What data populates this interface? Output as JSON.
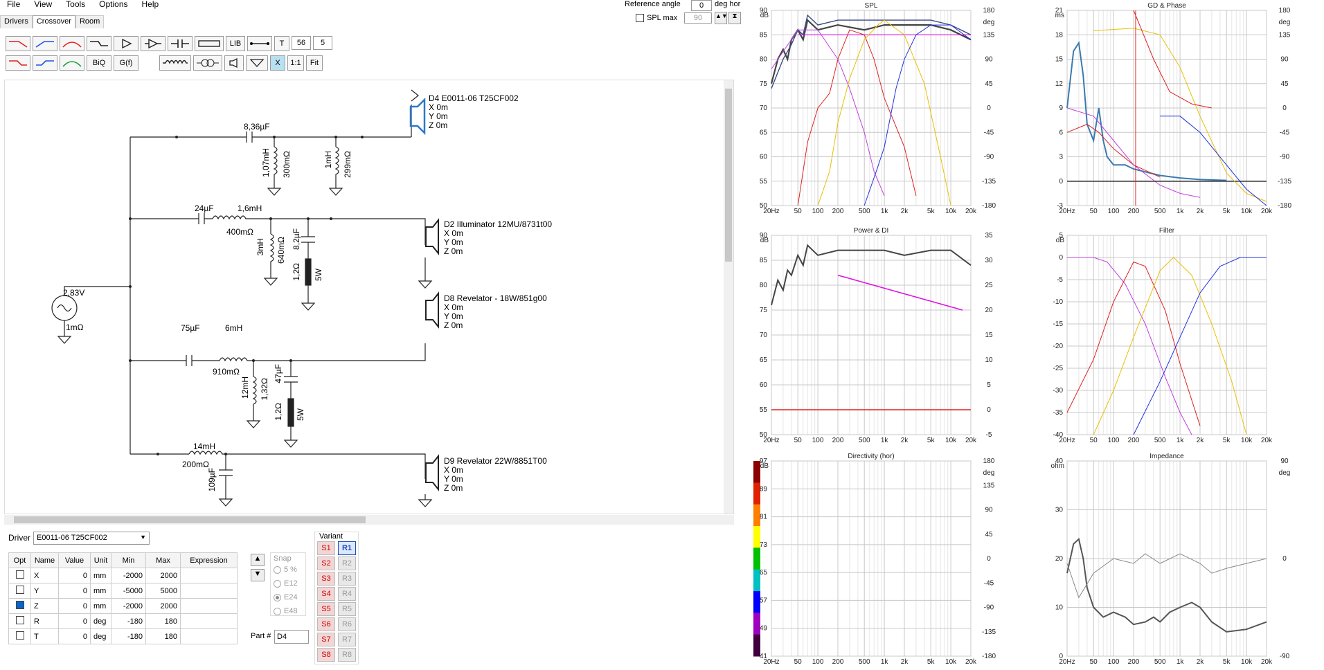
{
  "menu": [
    "File",
    "View",
    "Tools",
    "Options",
    "Help"
  ],
  "tabs": [
    "Drivers",
    "Crossover",
    "Room"
  ],
  "active_tab": "Crossover",
  "reference": {
    "label": "Reference angle",
    "value": "0",
    "unit": "deg hor",
    "splmax_label": "SPL max",
    "splmax_value": "90"
  },
  "toolbar": {
    "lib": "LIB",
    "t": "T",
    "num1": "56",
    "num2": "5",
    "biq": "BiQ",
    "gf": "G(f)",
    "x": "X",
    "oneone": "1:1",
    "fit": "Fit"
  },
  "schematic": {
    "source": {
      "voltage": "2,83V",
      "r": "1mΩ"
    },
    "labels": [
      "8,36µF",
      "1,07mH",
      "300mΩ",
      "1mH",
      "299mΩ",
      "24µF",
      "1,6mH",
      "400mΩ",
      "3mH",
      "640mΩ",
      "8,2µF",
      "1,2Ω",
      "5W",
      "75µF",
      "6mH",
      "910mΩ",
      "12mH",
      "1,32Ω",
      "47µF",
      "1,2Ω",
      "5W",
      "14mH",
      "200mΩ",
      "109µF"
    ],
    "drivers": [
      {
        "name": "D4 E0011-06 T25CF002",
        "x": "X 0m",
        "y": "Y 0m",
        "z": "Z 0m"
      },
      {
        "name": "D2 Illuminator 12MU/8731t00",
        "x": "X 0m",
        "y": "Y 0m",
        "z": "Z 0m"
      },
      {
        "name": "D8 Revelator - 18W/851g00",
        "x": "X 0m",
        "y": "Y 0m",
        "z": "Z 0m"
      },
      {
        "name": "D9 Revelator 22W/8851T00",
        "x": "X 0m",
        "y": "Y 0m",
        "z": "Z 0m"
      }
    ]
  },
  "driver_select": {
    "label": "Driver",
    "value": "E0011-06 T25CF002"
  },
  "param_table": {
    "headers": [
      "Opt",
      "Name",
      "Value",
      "Unit",
      "Min",
      "Max",
      "Expression"
    ],
    "rows": [
      {
        "name": "X",
        "value": "0",
        "unit": "mm",
        "min": "-2000",
        "max": "2000"
      },
      {
        "name": "Y",
        "value": "0",
        "unit": "mm",
        "min": "-5000",
        "max": "5000"
      },
      {
        "name": "Z",
        "value": "0",
        "unit": "mm",
        "min": "-2000",
        "max": "2000"
      },
      {
        "name": "R",
        "value": "0",
        "unit": "deg",
        "min": "-180",
        "max": "180"
      },
      {
        "name": "T",
        "value": "0",
        "unit": "deg",
        "min": "-180",
        "max": "180"
      }
    ]
  },
  "snap": {
    "label": "Snap",
    "options": [
      "5 %",
      "E12",
      "E24",
      "E48"
    ],
    "selected": "E24"
  },
  "part": {
    "label": "Part #",
    "value": "D4"
  },
  "variant": {
    "label": "Variant",
    "s": [
      "S1",
      "S2",
      "S3",
      "S4",
      "S5",
      "S6",
      "S7",
      "S8"
    ],
    "r": [
      "R1",
      "R2",
      "R3",
      "R4",
      "R5",
      "R6",
      "R7",
      "R8"
    ],
    "selected": "R1"
  },
  "graphs": {
    "spl": {
      "title": "SPL",
      "left_unit": "dB",
      "right_unit": "deg",
      "left_ticks": [
        "90",
        "85",
        "80",
        "75",
        "70",
        "65",
        "60",
        "55",
        "50"
      ],
      "right_ticks": [
        "180",
        "135",
        "90",
        "45",
        "0",
        "-45",
        "-90",
        "-135",
        "-180"
      ]
    },
    "gd": {
      "title": "GD & Phase",
      "left_unit": "ms",
      "right_unit": "deg",
      "left_ticks": [
        "21",
        "18",
        "15",
        "12",
        "9",
        "6",
        "3",
        "0",
        "-3"
      ],
      "right_ticks": [
        "180",
        "135",
        "90",
        "45",
        "0",
        "-45",
        "-90",
        "-135",
        "-180"
      ]
    },
    "power": {
      "title": "Power & DI",
      "left_unit": "dB",
      "left_ticks": [
        "90",
        "85",
        "80",
        "75",
        "70",
        "65",
        "60",
        "55",
        "50"
      ],
      "right_ticks": [
        "35",
        "30",
        "25",
        "20",
        "15",
        "10",
        "5",
        "0",
        "-5"
      ]
    },
    "filter": {
      "title": "Filter",
      "left_unit": "dB",
      "left_ticks": [
        "5",
        "0",
        "-5",
        "-10",
        "-15",
        "-20",
        "-25",
        "-30",
        "-35",
        "-40"
      ]
    },
    "directivity": {
      "title": "Directivity (hor)",
      "left_unit": "dB",
      "left_ticks": [
        "97",
        "89",
        "81",
        "73",
        "65",
        "57",
        "49",
        "41"
      ],
      "right_unit": "deg",
      "right_ticks": [
        "180",
        "135",
        "90",
        "45",
        "0",
        "-45",
        "-90",
        "-135",
        "-180"
      ]
    },
    "impedance": {
      "title": "Impedance",
      "left_unit": "ohm",
      "left_ticks": [
        "40",
        "30",
        "20",
        "10",
        "0"
      ],
      "right_unit": "deg",
      "right_ticks": [
        "90",
        "0",
        "-90"
      ]
    },
    "freq_ticks_a": [
      "20Hz",
      "50",
      "100",
      "200",
      "500",
      "1k",
      "2k",
      "5k",
      "10k",
      "20k"
    ],
    "freq_ticks_b": [
      "20Hz",
      "50",
      "100",
      "200",
      "500",
      "1k",
      "2k",
      "5k",
      "10k",
      "20k"
    ]
  }
}
